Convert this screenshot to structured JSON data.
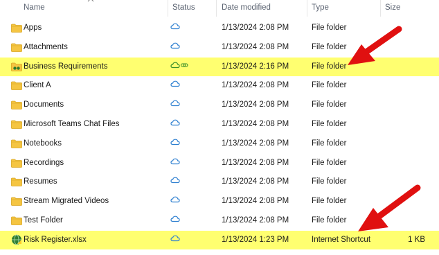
{
  "columns": {
    "name": "Name",
    "status": "Status",
    "date": "Date modified",
    "type": "Type",
    "size": "Size"
  },
  "rows": [
    {
      "name": "Apps",
      "date": "1/13/2024 2:08 PM",
      "type": "File folder",
      "size": "",
      "icon": "folder-icon",
      "status": "cloud-icon",
      "highlight": false
    },
    {
      "name": "Attachments",
      "date": "1/13/2024 2:08 PM",
      "type": "File folder",
      "size": "",
      "icon": "folder-icon",
      "status": "cloud-icon",
      "highlight": false
    },
    {
      "name": "Business Requirements",
      "date": "1/13/2024 2:16 PM",
      "type": "File folder",
      "size": "",
      "icon": "shared-folder-icon",
      "status": "cloud-link-icon",
      "highlight": true
    },
    {
      "name": "Client A",
      "date": "1/13/2024 2:08 PM",
      "type": "File folder",
      "size": "",
      "icon": "folder-icon",
      "status": "cloud-icon",
      "highlight": false
    },
    {
      "name": "Documents",
      "date": "1/13/2024 2:08 PM",
      "type": "File folder",
      "size": "",
      "icon": "folder-icon",
      "status": "cloud-icon",
      "highlight": false
    },
    {
      "name": "Microsoft Teams Chat Files",
      "date": "1/13/2024 2:08 PM",
      "type": "File folder",
      "size": "",
      "icon": "folder-icon",
      "status": "cloud-icon",
      "highlight": false
    },
    {
      "name": "Notebooks",
      "date": "1/13/2024 2:08 PM",
      "type": "File folder",
      "size": "",
      "icon": "folder-icon",
      "status": "cloud-icon",
      "highlight": false
    },
    {
      "name": "Recordings",
      "date": "1/13/2024 2:08 PM",
      "type": "File folder",
      "size": "",
      "icon": "folder-icon",
      "status": "cloud-icon",
      "highlight": false
    },
    {
      "name": "Resumes",
      "date": "1/13/2024 2:08 PM",
      "type": "File folder",
      "size": "",
      "icon": "folder-icon",
      "status": "cloud-icon",
      "highlight": false
    },
    {
      "name": "Stream Migrated Videos",
      "date": "1/13/2024 2:08 PM",
      "type": "File folder",
      "size": "",
      "icon": "folder-icon",
      "status": "cloud-icon",
      "highlight": false
    },
    {
      "name": "Test Folder",
      "date": "1/13/2024 2:08 PM",
      "type": "File folder",
      "size": "",
      "icon": "folder-icon",
      "status": "cloud-icon",
      "highlight": false
    },
    {
      "name": "Risk Register.xlsx",
      "date": "1/13/2024 1:23 PM",
      "type": "Internet Shortcut",
      "size": "1 KB",
      "icon": "internet-shortcut-icon",
      "status": "cloud-icon",
      "highlight": true
    }
  ],
  "colors": {
    "highlight": "#ffff70",
    "cloud_outline": "#2d7fd0",
    "cloud_synced": "#3a8f2a",
    "folder": "#f5c542",
    "arrow": "#e01010"
  }
}
